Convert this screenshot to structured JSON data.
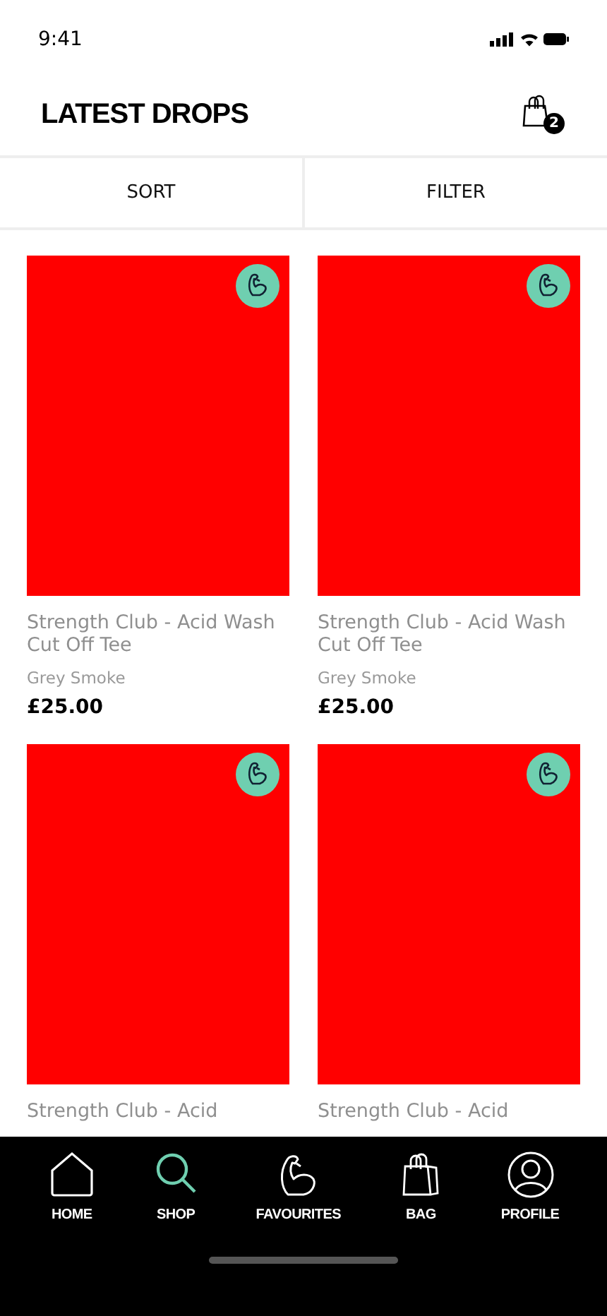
{
  "status_bar": {
    "time": "9:41"
  },
  "header": {
    "title": "LATEST DROPS",
    "bag_count": "2"
  },
  "toolbar": [
    "SORT",
    "FILTER"
  ],
  "products": [
    {
      "title": "Strength Club - Acid Wash Cut Off Tee",
      "colour": "Grey Smoke",
      "price": "£25.00",
      "favourite": true
    },
    {
      "title": "Strength Club - Acid Wash Cut Off Tee",
      "colour": "Grey Smoke",
      "price": "£25.00",
      "favourite": true
    },
    {
      "title": "Strength Club - Acid",
      "favourite": true
    },
    {
      "title": "Strength Club - Acid",
      "favourite": true
    }
  ],
  "nav": [
    {
      "kind": "home",
      "label": "HOME",
      "selected": false
    },
    {
      "kind": "search",
      "label": "SHOP",
      "selected": true
    },
    {
      "kind": "flex",
      "label": "FAVOURITES",
      "selected": false
    },
    {
      "kind": "bag",
      "label": "BAG",
      "selected": false
    },
    {
      "kind": "profile",
      "label": "PROFILE",
      "selected": false
    }
  ]
}
